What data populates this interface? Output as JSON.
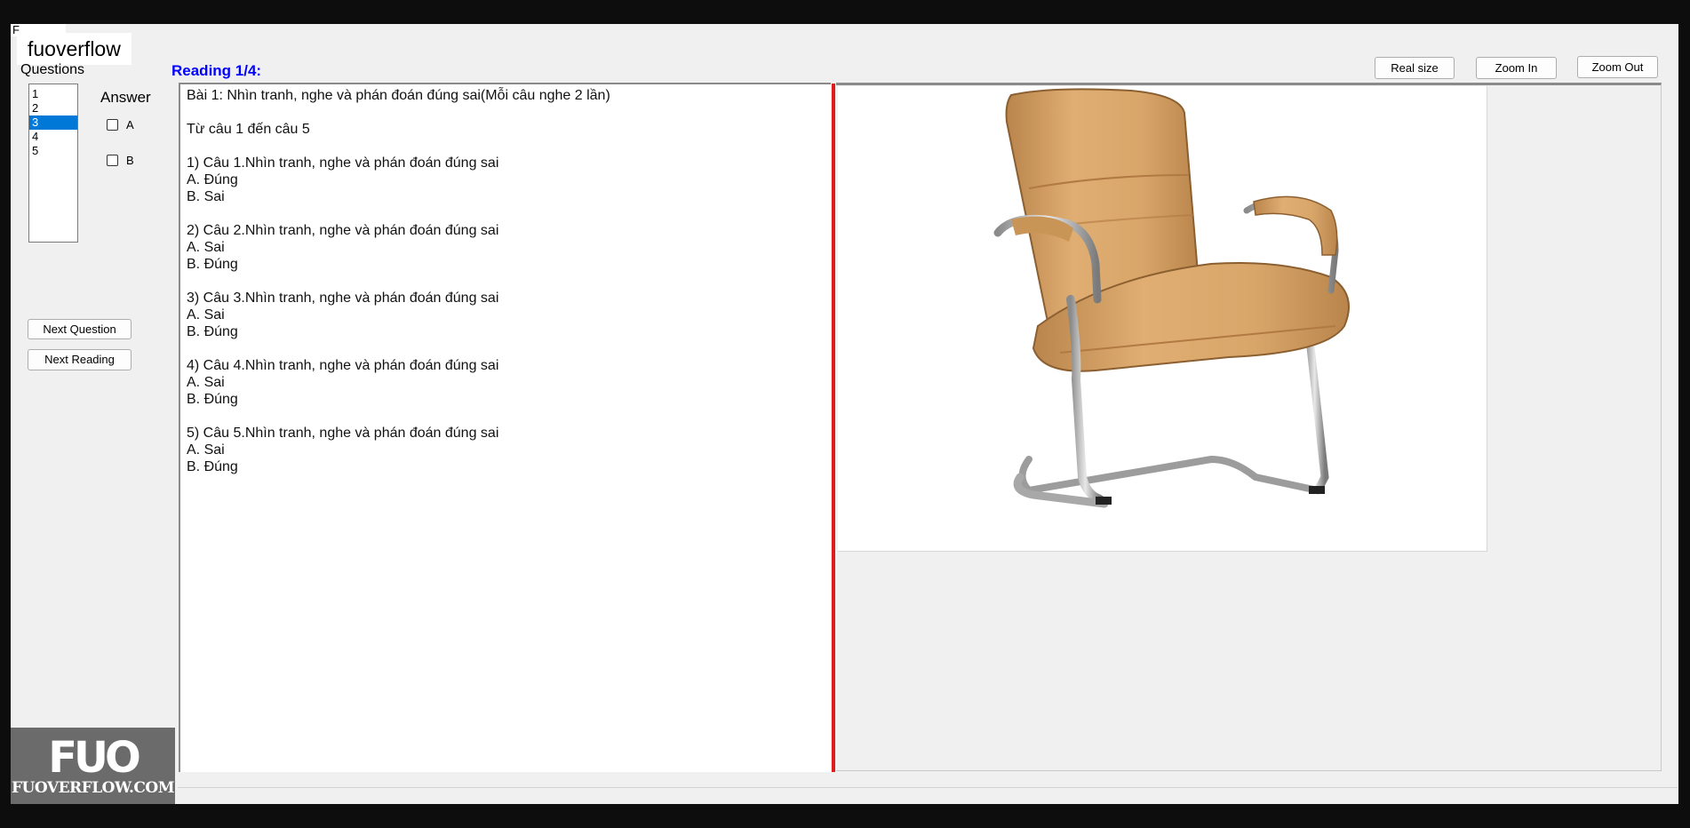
{
  "window": {
    "tab_stub": "F",
    "brand_label": "fuoverflow"
  },
  "questions": {
    "label": "Questions",
    "items": [
      "1",
      "2",
      "3",
      "4",
      "5"
    ],
    "selected": "3"
  },
  "answer": {
    "label": "Answer",
    "options": [
      "A",
      "B"
    ]
  },
  "buttons": {
    "next_question": "Next Question",
    "next_reading": "Next Reading",
    "real_size": "Real size",
    "zoom_in": "Zoom In",
    "zoom_out": "Zoom Out"
  },
  "reading": {
    "title": "Reading 1/4:",
    "lines": [
      "Bài 1: Nhìn tranh, nghe và phán đoán đúng sai(Mỗi câu nghe 2 lần)",
      "",
      "Từ câu 1 đến câu 5",
      "",
      "1) Câu 1.Nhìn tranh, nghe và phán đoán đúng sai",
      "A. Đúng",
      "B. Sai",
      "",
      "2) Câu 2.Nhìn tranh, nghe và phán đoán đúng sai",
      "A. Sai",
      "B. Đúng",
      "",
      "3) Câu 3.Nhìn tranh, nghe và phán đoán đúng sai",
      "A. Sai",
      "B. Đúng",
      "",
      "4) Câu 4.Nhìn tranh, nghe và phán đoán đúng sai",
      "A. Sai",
      "B. Đúng",
      "",
      "5) Câu 5.Nhìn tranh, nghe và phán đoán đúng sai",
      "A. Sai",
      "B. Đúng"
    ]
  },
  "image": {
    "subject": "beige leather office chair with chrome cantilever frame",
    "colors": {
      "leather": "#d9a66a",
      "leather_shadow": "#b9854c",
      "chrome": "#b8b8b8"
    }
  },
  "logo": {
    "mark": "FUO",
    "text": "FUOVERFLOW.COM"
  },
  "colors": {
    "selection": "#0078d7",
    "reading_title": "#0000ff",
    "divider": "#e01b1b"
  }
}
